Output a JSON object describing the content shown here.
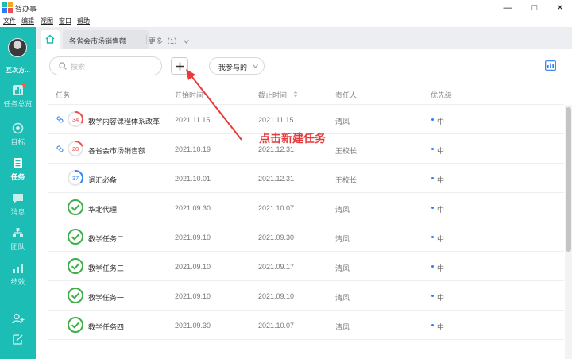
{
  "app": {
    "title": "智办事"
  },
  "menu": [
    "文件",
    "编辑",
    "视图",
    "窗口",
    "帮助"
  ],
  "sidebar": {
    "user_name": "互次方...",
    "items": [
      {
        "label": "任务总览",
        "icon": "overview-icon",
        "badge": true
      },
      {
        "label": "目标",
        "icon": "target-icon"
      },
      {
        "label": "任务",
        "icon": "task-icon",
        "active": true
      },
      {
        "label": "消息",
        "icon": "message-icon"
      },
      {
        "label": "团队",
        "icon": "team-icon"
      },
      {
        "label": "绩效",
        "icon": "performance-icon"
      }
    ]
  },
  "tabs": {
    "current_doc": "各省会市场销售额",
    "more": "更多（1）"
  },
  "toolbar": {
    "search_placeholder": "搜索",
    "filter_label": "我参与的"
  },
  "table": {
    "headers": {
      "task": "任务",
      "start": "开始时间",
      "end": "截止时间",
      "owner": "责任人",
      "priority": "优先级"
    },
    "rows": [
      {
        "name": "教学内容课程体系改革",
        "progress": "34",
        "ring_color": "#ec4d4d",
        "linked": true,
        "start": "2021.11.15",
        "end": "2021.11.15",
        "owner": "清风",
        "priority": "中"
      },
      {
        "name": "各省会市场销售额",
        "progress": "20",
        "ring_color": "#ec4d4d",
        "linked": true,
        "start": "2021.10.19",
        "end": "2021.12.31",
        "owner": "王校长",
        "priority": "中"
      },
      {
        "name": "词汇必备",
        "progress": "37",
        "ring_color": "#3a86f0",
        "linked": false,
        "start": "2021.10.01",
        "end": "2021.12.31",
        "owner": "王校长",
        "priority": "中"
      },
      {
        "name": "华北代理",
        "progress": "done",
        "ring_color": "#3fae49",
        "linked": false,
        "start": "2021.09.30",
        "end": "2021.10.07",
        "owner": "清风",
        "priority": "中"
      },
      {
        "name": "教学任务二",
        "progress": "done",
        "ring_color": "#3fae49",
        "linked": false,
        "start": "2021.09.10",
        "end": "2021.09.30",
        "owner": "清风",
        "priority": "中"
      },
      {
        "name": "教学任务三",
        "progress": "done",
        "ring_color": "#3fae49",
        "linked": false,
        "start": "2021.09.10",
        "end": "2021.09.17",
        "owner": "清风",
        "priority": "中"
      },
      {
        "name": "教学任务一",
        "progress": "done",
        "ring_color": "#3fae49",
        "linked": false,
        "start": "2021.09.10",
        "end": "2021.09.10",
        "owner": "清风",
        "priority": "中"
      },
      {
        "name": "教学任务四",
        "progress": "done",
        "ring_color": "#3fae49",
        "linked": false,
        "start": "2021.09.30",
        "end": "2021.10.07",
        "owner": "清风",
        "priority": "中"
      }
    ]
  },
  "annotation": {
    "text": "点击新建任务"
  },
  "colors": {
    "sidebar": "#1bbdb5",
    "accent": "#2d7cf6",
    "annotation": "#e83a3a",
    "done": "#3fae49"
  }
}
